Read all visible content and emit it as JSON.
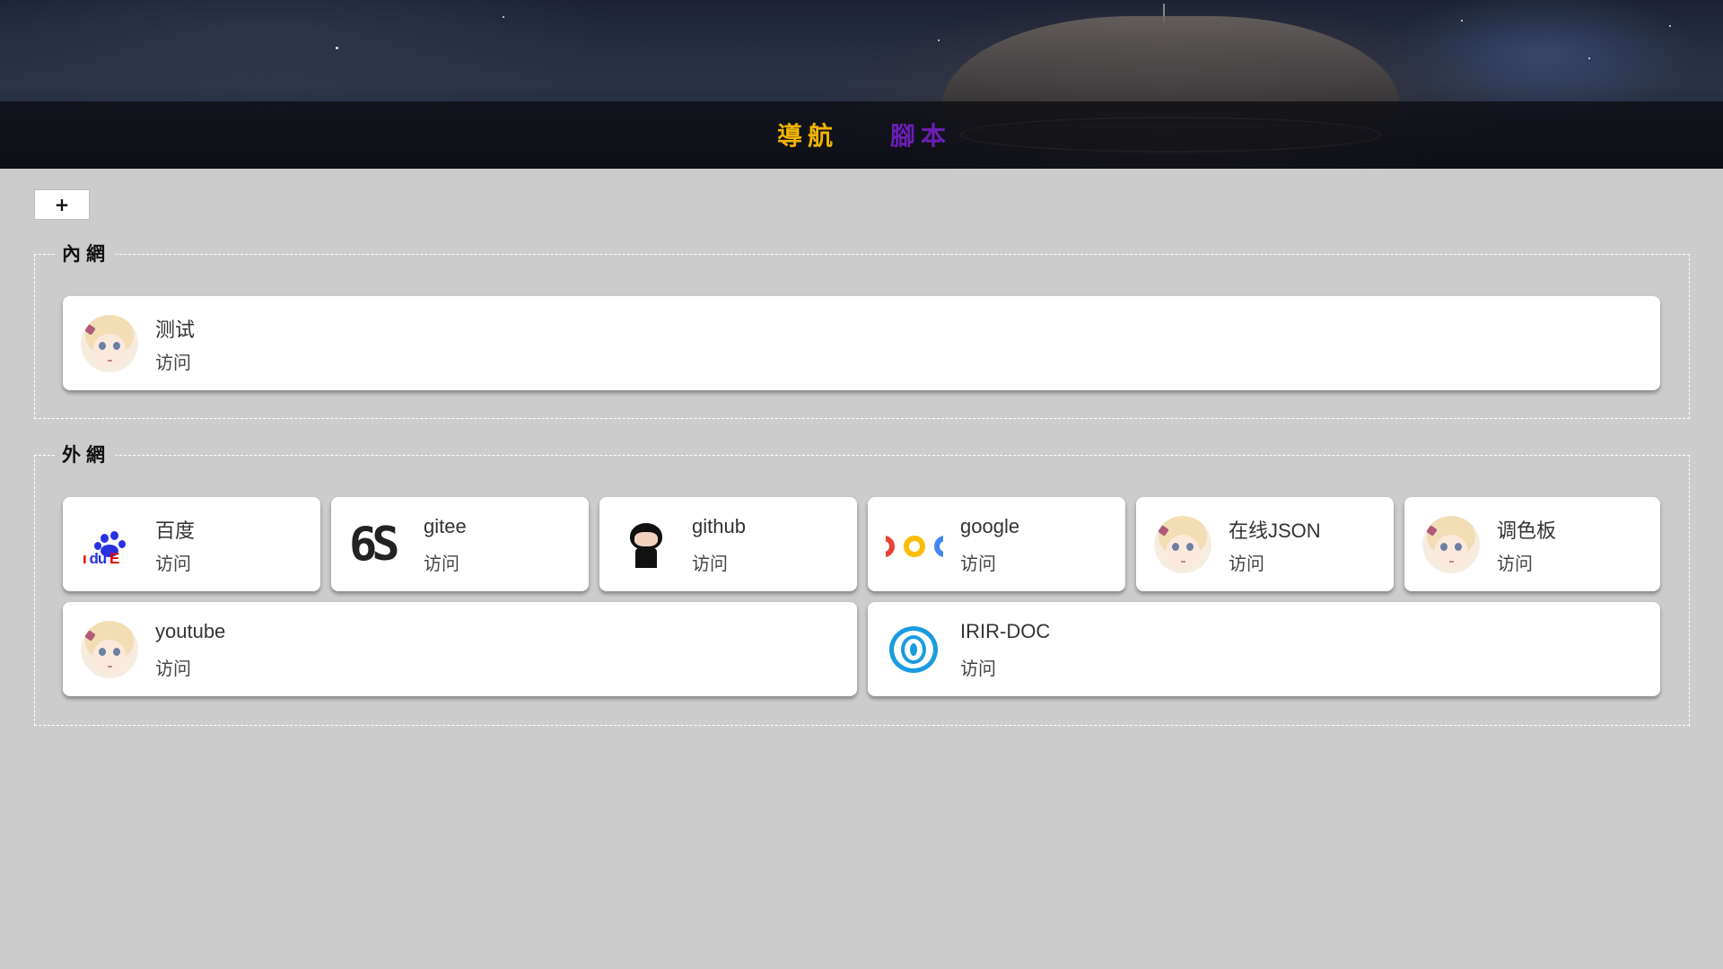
{
  "header": {
    "nav_links": [
      {
        "label": "導航",
        "color": "#f0b400"
      },
      {
        "label": "腳本",
        "color": "#6a1fb4"
      }
    ]
  },
  "toolbar": {
    "add_label": "+"
  },
  "groups": [
    {
      "legend": "內網",
      "cards": [
        {
          "title": "测试",
          "visit": "访问",
          "icon": "avatar-icon"
        }
      ]
    },
    {
      "legend": "外網",
      "cards": [
        {
          "title": "百度",
          "visit": "访问",
          "icon": "baidu-icon"
        },
        {
          "title": "gitee",
          "visit": "访问",
          "icon": "gitee-icon"
        },
        {
          "title": "github",
          "visit": "访问",
          "icon": "github-icon"
        },
        {
          "title": "google",
          "visit": "访问",
          "icon": "google-icon"
        },
        {
          "title": "在线JSON",
          "visit": "访问",
          "icon": "avatar-icon"
        },
        {
          "title": "调色板",
          "visit": "访问",
          "icon": "avatar-icon"
        },
        {
          "title": "youtube",
          "visit": "访问",
          "icon": "avatar-icon"
        },
        {
          "title": "IRIR-DOC",
          "visit": "访问",
          "icon": "irir-doc-icon"
        }
      ]
    }
  ]
}
